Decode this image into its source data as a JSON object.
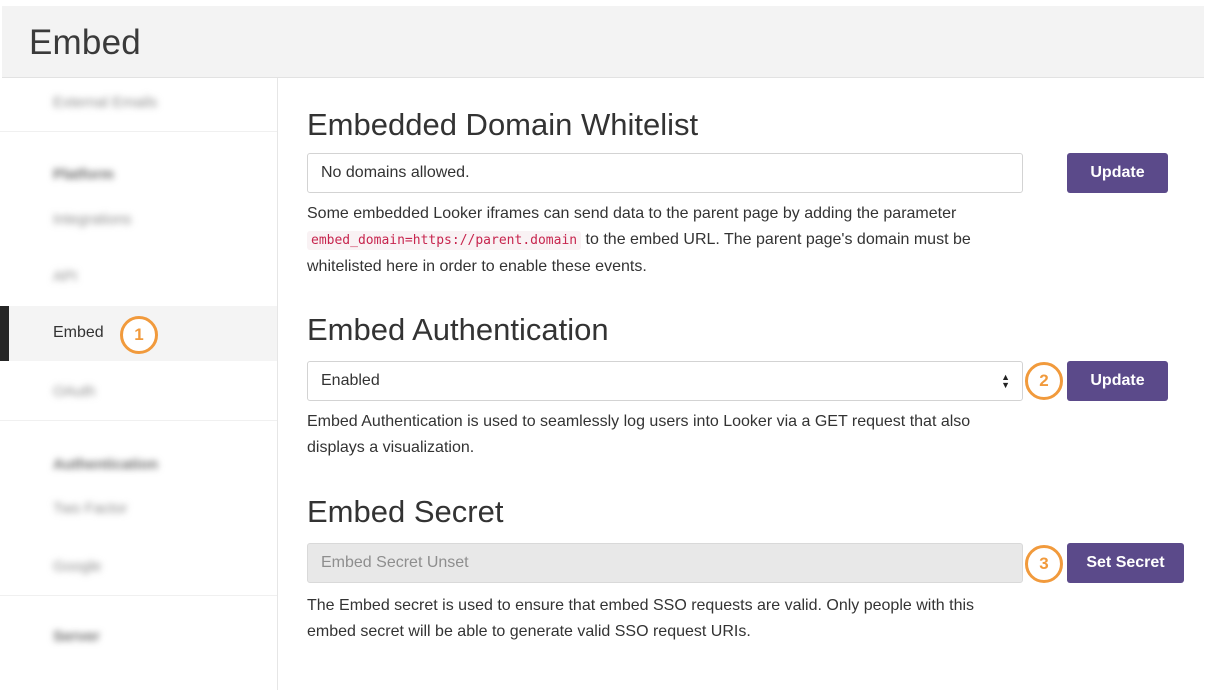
{
  "header": {
    "title": "Embed"
  },
  "sidebar": {
    "items": [
      {
        "label": "External Emails",
        "blurred": true
      },
      {
        "label": "Platform",
        "heading": true,
        "blurred": true
      },
      {
        "label": "Integrations",
        "blurred": true
      },
      {
        "label": "API",
        "blurred": true
      },
      {
        "label": "Embed",
        "active": true
      },
      {
        "label": "OAuth",
        "blurred": true
      },
      {
        "label": "Authentication",
        "heading": true,
        "blurred": true
      },
      {
        "label": "Two Factor",
        "blurred": true
      },
      {
        "label": "Google",
        "blurred": true
      },
      {
        "label": "Server",
        "heading": true,
        "blurred": true
      }
    ]
  },
  "callouts": [
    "1",
    "2",
    "3"
  ],
  "sections": {
    "whitelist": {
      "title": "Embedded Domain Whitelist",
      "input_value": "No domains allowed.",
      "button_label": "Update",
      "desc_before": "Some embedded Looker iframes can send data to the parent page by adding the parameter ",
      "desc_code": "embed_domain=https://parent.domain",
      "desc_after": " to the embed URL. The parent page's domain must be whitelisted here in order to enable these events."
    },
    "auth": {
      "title": "Embed Authentication",
      "select_value": "Enabled",
      "button_label": "Update",
      "desc": "Embed Authentication is used to seamlessly log users into Looker via a GET request that also displays a visualization."
    },
    "secret": {
      "title": "Embed Secret",
      "input_value": "Embed Secret Unset",
      "button_label": "Set Secret",
      "desc": "The Embed secret is used to ensure that embed SSO requests are valid. Only people with this embed secret will be able to generate valid SSO request URIs."
    }
  },
  "colors": {
    "button": "#5b4a8a",
    "callout": "#f19a3c",
    "code": "#c7254e",
    "active_bar": "#262626"
  }
}
